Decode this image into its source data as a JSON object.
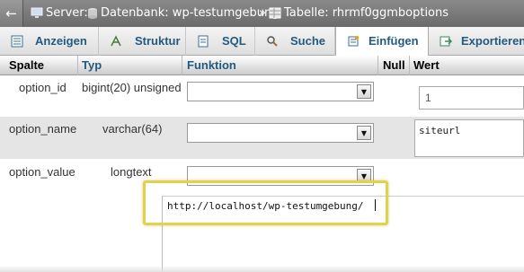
{
  "breadcrumb": {
    "server_label": "Server:",
    "database_label": "Datenbank: wp-testumgebung",
    "separator": "»",
    "table_label": "Tabelle: rhrmf0ggmboptions"
  },
  "icons": {
    "back": "left-arrow-icon",
    "server": "server-icon",
    "database": "database-icon",
    "table": "table-icon",
    "anzeigen": "browse-icon",
    "struktur": "structure-icon",
    "sql": "sql-icon",
    "suche": "search-icon",
    "einfuegen": "insert-icon",
    "exportieren": "export-icon"
  },
  "tabs": [
    {
      "label": "Anzeigen",
      "active": false
    },
    {
      "label": "Struktur",
      "active": false
    },
    {
      "label": "SQL",
      "active": false
    },
    {
      "label": "Suche",
      "active": false
    },
    {
      "label": "Einfügen",
      "active": true
    },
    {
      "label": "Exportieren",
      "active": false
    }
  ],
  "table": {
    "headers": {
      "spalte": "Spalte",
      "typ": "Typ",
      "funktion": "Funktion",
      "null": "Null",
      "wert": "Wert"
    },
    "rows": [
      {
        "column": "option_id",
        "type": "bigint(20) unsigned",
        "function": "",
        "value": "1"
      },
      {
        "column": "option_name",
        "type": "varchar(64)",
        "function": "",
        "value": "siteurl"
      },
      {
        "column": "option_value",
        "type": "longtext",
        "function": "",
        "value": "http://localhost/wp-testumgebung/"
      }
    ]
  },
  "colors": {
    "link_blue": "#235a81",
    "highlight": "#e2d24a",
    "breadcrumb_bg": "#7a7a7a"
  }
}
